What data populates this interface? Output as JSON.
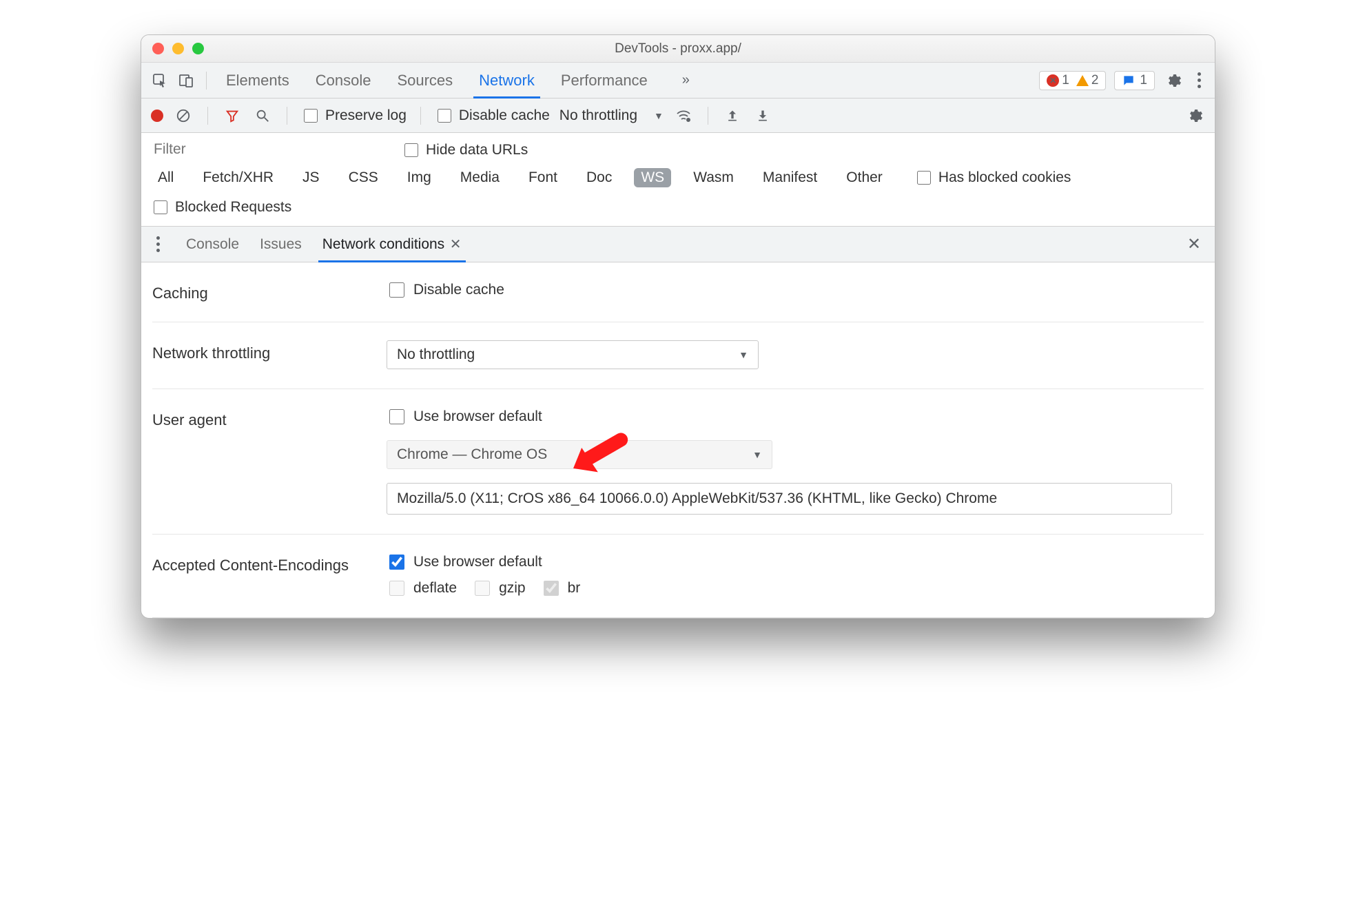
{
  "window": {
    "title": "DevTools - proxx.app/"
  },
  "tabs": {
    "items": [
      "Elements",
      "Console",
      "Sources",
      "Network",
      "Performance"
    ],
    "active": "Network",
    "moreGlyph": "»"
  },
  "badges": {
    "errors": "1",
    "warnings": "2",
    "messages": "1"
  },
  "netToolbar": {
    "preserveLog": "Preserve log",
    "disableCache": "Disable cache",
    "throttling": "No throttling"
  },
  "filterRow": {
    "placeholder": "Filter",
    "hideDataUrls": "Hide data URLs"
  },
  "types": {
    "items": [
      "All",
      "Fetch/XHR",
      "JS",
      "CSS",
      "Img",
      "Media",
      "Font",
      "Doc",
      "WS",
      "Wasm",
      "Manifest",
      "Other"
    ],
    "active": "WS",
    "hasBlockedCookies": "Has blocked cookies"
  },
  "blockedRequests": "Blocked Requests",
  "drawer": {
    "tabs": [
      "Console",
      "Issues",
      "Network conditions"
    ],
    "active": "Network conditions"
  },
  "form": {
    "caching": {
      "label": "Caching",
      "disableCache": "Disable cache"
    },
    "throttling": {
      "label": "Network throttling",
      "value": "No throttling"
    },
    "userAgent": {
      "label": "User agent",
      "useDefault": "Use browser default",
      "preset": "Chrome — Chrome OS",
      "uaString": "Mozilla/5.0 (X11; CrOS x86_64 10066.0.0) AppleWebKit/537.36 (KHTML, like Gecko) Chrome"
    },
    "encodings": {
      "label": "Accepted Content-Encodings",
      "useDefault": "Use browser default",
      "opts": [
        "deflate",
        "gzip",
        "br"
      ]
    }
  }
}
